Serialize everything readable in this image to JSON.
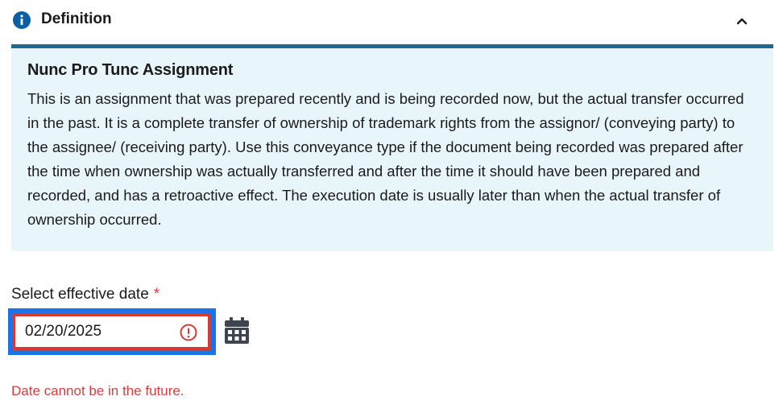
{
  "accordion": {
    "title": "Definition",
    "info_icon": "info-circle-icon",
    "toggle_icon": "chevron-up-icon",
    "expanded": true
  },
  "definition": {
    "title": "Nunc Pro Tunc Assignment",
    "body": "This is an assignment that was prepared recently and is being recorded now, but the actual transfer occurred in the past. It is a complete transfer of ownership of trademark rights from the assignor/ (conveying party) to the assignee/ (receiving party). Use this conveyance type if the document being recorded was prepared after the time when ownership was actually transferred and after the time it should have been prepared and recorded, and has a retroactive effect. The execution date is usually later than when the actual transfer of ownership occurred."
  },
  "date_field": {
    "label": "Select effective date",
    "required_marker": "*",
    "value": "02/20/2025",
    "error_icon": "alert-circle-icon",
    "calendar_icon": "calendar-icon",
    "error_message": "Date cannot be in the future."
  },
  "colors": {
    "accent_rule": "#1a6c8c",
    "panel_background": "#e8f5fa",
    "info_icon": "#0b5fa5",
    "error": "#d83933",
    "focus_ring": "#1a74e8"
  }
}
